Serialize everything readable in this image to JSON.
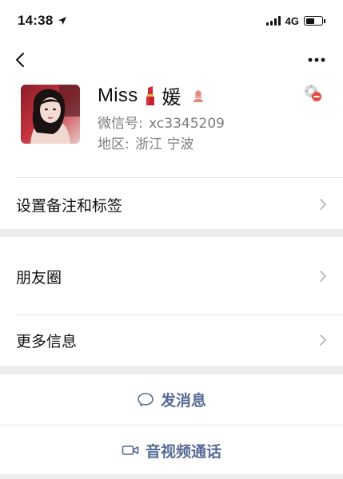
{
  "status_bar": {
    "time": "14:38",
    "network": "4G",
    "battery_level": 0.55,
    "icons": [
      "location-arrow-icon",
      "signal-icon",
      "battery-icon"
    ]
  },
  "nav": {
    "back_icon": "chevron-left-icon",
    "more_icon": "more-dots-icon"
  },
  "profile": {
    "name": "Miss",
    "name_suffix": "媛",
    "wechat_id_label": "微信号:",
    "wechat_id": "xc3345209",
    "region_label": "地区:",
    "region": "浙江 宁波",
    "gender": "female",
    "icons": [
      "avatar-photo",
      "lipstick-emoji",
      "female-icon",
      "star-friend-icon"
    ]
  },
  "rows": [
    {
      "label": "设置备注和标签"
    },
    {
      "label": "朋友圈"
    },
    {
      "label": "更多信息"
    }
  ],
  "actions": {
    "message": "发消息",
    "video_call": "音视频通话"
  },
  "colors": {
    "link": "#576b95",
    "secondary_text": "#7d7d7d",
    "separator_band": "#ededed",
    "gender_female": "#e6897f",
    "star_badge": "#e84b41"
  }
}
